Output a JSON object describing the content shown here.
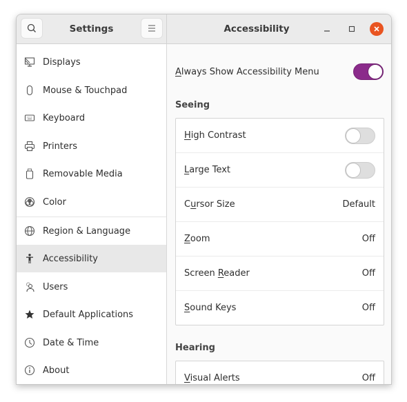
{
  "window": {
    "sidebar_title": "Settings",
    "panel_title": "Accessibility",
    "controls": [
      "minimize",
      "maximize",
      "close"
    ]
  },
  "sidebar": {
    "items": [
      {
        "label": "Displays",
        "icon": "display-icon",
        "active": false
      },
      {
        "label": "Mouse & Touchpad",
        "icon": "mouse-icon",
        "active": false
      },
      {
        "label": "Keyboard",
        "icon": "keyboard-icon",
        "active": false
      },
      {
        "label": "Printers",
        "icon": "printer-icon",
        "active": false
      },
      {
        "label": "Removable Media",
        "icon": "usb-drive-icon",
        "active": false
      },
      {
        "label": "Color",
        "icon": "color-icon",
        "active": false
      },
      {
        "label": "Region & Language",
        "icon": "globe-icon",
        "active": false
      },
      {
        "label": "Accessibility",
        "icon": "accessibility-icon",
        "active": true
      },
      {
        "label": "Users",
        "icon": "users-icon",
        "active": false
      },
      {
        "label": "Default Applications",
        "icon": "star-icon",
        "active": false
      },
      {
        "label": "Date & Time",
        "icon": "clock-icon",
        "active": false
      },
      {
        "label": "About",
        "icon": "info-icon",
        "active": false
      }
    ]
  },
  "content": {
    "always_show": {
      "pre": "",
      "mnemonic": "A",
      "post": "lways Show Accessibility Menu",
      "value": true
    },
    "seeing": {
      "heading": "Seeing",
      "rows": [
        {
          "pre": "",
          "mnemonic": "H",
          "post": "igh Contrast",
          "type": "switch",
          "value": false
        },
        {
          "pre": "",
          "mnemonic": "L",
          "post": "arge Text",
          "type": "switch",
          "value": false
        },
        {
          "pre": "C",
          "mnemonic": "u",
          "post": "rsor Size",
          "type": "value",
          "value": "Default"
        },
        {
          "pre": "",
          "mnemonic": "Z",
          "post": "oom",
          "type": "value",
          "value": "Off"
        },
        {
          "pre": "Screen ",
          "mnemonic": "R",
          "post": "eader",
          "type": "value",
          "value": "Off"
        },
        {
          "pre": "",
          "mnemonic": "S",
          "post": "ound Keys",
          "type": "value",
          "value": "Off"
        }
      ]
    },
    "hearing": {
      "heading": "Hearing",
      "rows": [
        {
          "pre": "",
          "mnemonic": "V",
          "post": "isual Alerts",
          "type": "value",
          "value": "Off"
        }
      ]
    }
  },
  "colors": {
    "accent": "#8b2b8b",
    "close": "#e95420",
    "active_row": "#e8e8e8"
  }
}
